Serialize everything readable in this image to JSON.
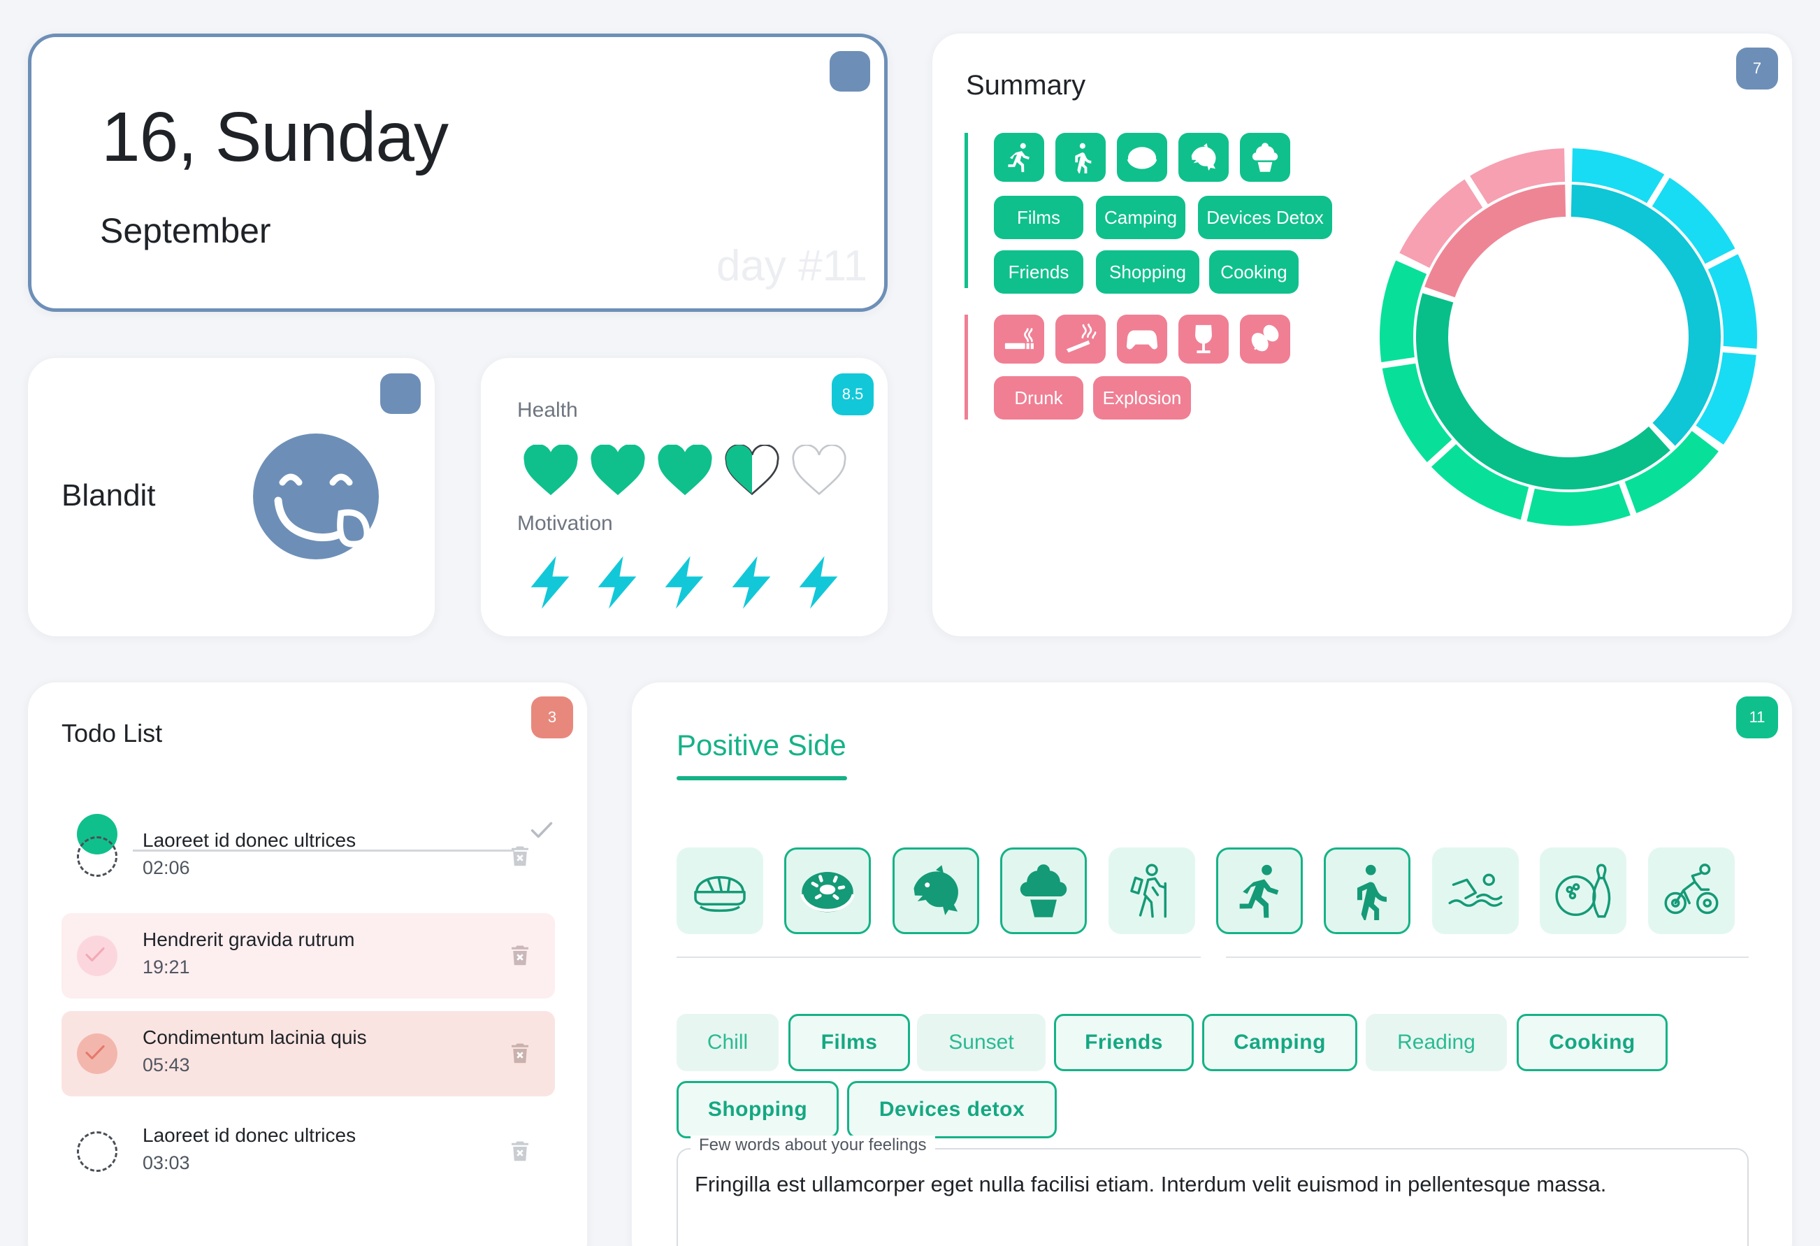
{
  "date_card": {
    "day": "16, Sunday",
    "month": "September",
    "day_number": "day #11"
  },
  "mood_card": {
    "label": "Blandit",
    "icon": "yummy-face-icon"
  },
  "health_card": {
    "badge": "8.5",
    "health_label": "Health",
    "motivation_label": "Motivation",
    "health_value": 3.5,
    "health_max": 5,
    "motivation_value": 5,
    "motivation_max": 5
  },
  "summary": {
    "title": "Summary",
    "badge": "7",
    "positive_icons": [
      "running-icon",
      "walking-icon",
      "donut-icon",
      "dolphin-icon",
      "ice-cream-icon"
    ],
    "positive_tags": [
      "Films",
      "Camping",
      "Devices Detox",
      "Friends",
      "Shopping",
      "Cooking"
    ],
    "negative_icons": [
      "cigarette-icon",
      "joint-icon",
      "gamepad-icon",
      "wine-glass-icon",
      "coffee-beans-icon"
    ],
    "negative_tags": [
      "Drunk",
      "Explosion"
    ],
    "colors": {
      "positive": "#0fc08c",
      "negative": "#f07f94",
      "cyan": "#10cde0"
    }
  },
  "chart_data": {
    "type": "pie",
    "rings": [
      {
        "name": "outer",
        "slices": [
          {
            "value": 0.35,
            "color": "#18dcf3"
          },
          {
            "value": 0.47,
            "color": "#08e09a"
          },
          {
            "value": 0.18,
            "color": "#f6a0b2"
          }
        ]
      },
      {
        "name": "inner",
        "slices": [
          {
            "value": 0.38,
            "color": "#0ec6d6"
          },
          {
            "value": 0.42,
            "color": "#08bf8a"
          },
          {
            "value": 0.2,
            "color": "#ee8595"
          }
        ]
      }
    ]
  },
  "todo": {
    "title": "Todo List",
    "badge": "3",
    "input_value": "",
    "items": [
      {
        "title": "Laoreet id donec ultrices",
        "time": "02:06",
        "state": "open"
      },
      {
        "title": "Hendrerit gravida rutrum",
        "time": "19:21",
        "state": "done-light"
      },
      {
        "title": "Condimentum lacinia quis",
        "time": "05:43",
        "state": "done"
      },
      {
        "title": "Laoreet id donec ultrices",
        "time": "03:03",
        "state": "open"
      }
    ]
  },
  "positive": {
    "title": "Positive Side",
    "badge": "11",
    "icons": [
      {
        "name": "sushi-icon",
        "selected": false
      },
      {
        "name": "donut-icon",
        "selected": true
      },
      {
        "name": "dolphin-icon",
        "selected": true
      },
      {
        "name": "ice-cream-icon",
        "selected": true
      },
      {
        "name": "hiking-icon",
        "selected": false
      },
      {
        "name": "running-icon",
        "selected": true
      },
      {
        "name": "walking-icon",
        "selected": true
      },
      {
        "name": "swimming-icon",
        "selected": false
      },
      {
        "name": "bowling-icon",
        "selected": false
      },
      {
        "name": "cycling-icon",
        "selected": false
      }
    ],
    "chips": [
      {
        "label": "Chill",
        "selected": false
      },
      {
        "label": "Films",
        "selected": true
      },
      {
        "label": "Sunset",
        "selected": false
      },
      {
        "label": "Friends",
        "selected": true
      },
      {
        "label": "Camping",
        "selected": true
      },
      {
        "label": "Reading",
        "selected": false
      },
      {
        "label": "Cooking",
        "selected": true
      },
      {
        "label": "Shopping",
        "selected": true
      },
      {
        "label": "Devices detox",
        "selected": true
      }
    ],
    "feelings_label": "Few words about your feelings",
    "feelings_text": "Fringilla est ullamcorper eget nulla facilisi etiam. Interdum velit euismod in pellentesque massa."
  },
  "accent_colors": {
    "slate": "#6d8fb7",
    "teal": "#0fc08c",
    "coral": "#e8887c",
    "cyan": "#12c8d8"
  }
}
